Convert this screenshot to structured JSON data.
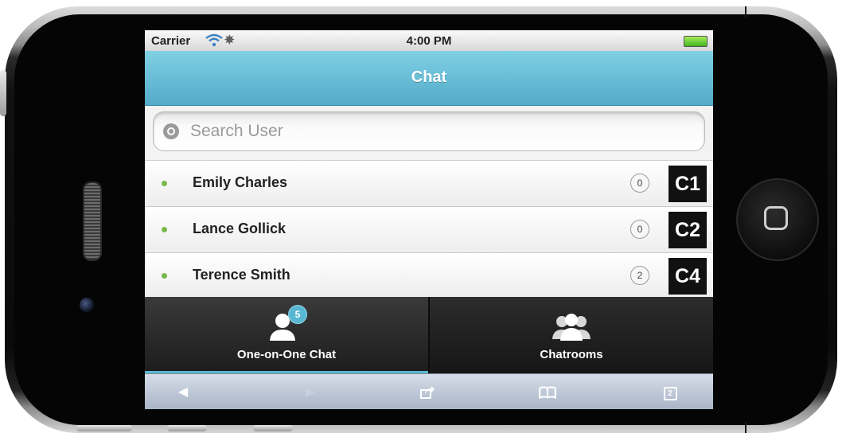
{
  "status_bar": {
    "carrier": "Carrier",
    "time": "4:00 PM",
    "wifi_icon": "wifi-icon",
    "activity_icon": "spinner-icon",
    "battery_icon": "battery-icon"
  },
  "header": {
    "title": "Chat",
    "color": "#6cc2dc"
  },
  "search": {
    "placeholder": "Search User",
    "icon": "search-icon"
  },
  "users": [
    {
      "name": "Emily Charles",
      "count": "0",
      "code": "C1",
      "online": true
    },
    {
      "name": "Lance Gollick",
      "count": "0",
      "code": "C2",
      "online": true
    },
    {
      "name": "Terence Smith",
      "count": "2",
      "code": "C4",
      "online": true
    }
  ],
  "tabs": [
    {
      "label": "One-on-One Chat",
      "icon": "user-icon",
      "badge": "5",
      "active": true
    },
    {
      "label": "Chatrooms",
      "icon": "group-icon",
      "active": false
    }
  ],
  "browser_toolbar": {
    "back_icon": "back-arrow-icon",
    "forward_icon": "forward-arrow-icon",
    "share_icon": "share-icon",
    "bookmarks_icon": "bookmarks-icon",
    "tabs_icon": "tabs-icon",
    "tabs_count": "2"
  },
  "colors": {
    "accent": "#59b7d3",
    "online": "#78b848",
    "tabbar": "#1d1d1d"
  }
}
